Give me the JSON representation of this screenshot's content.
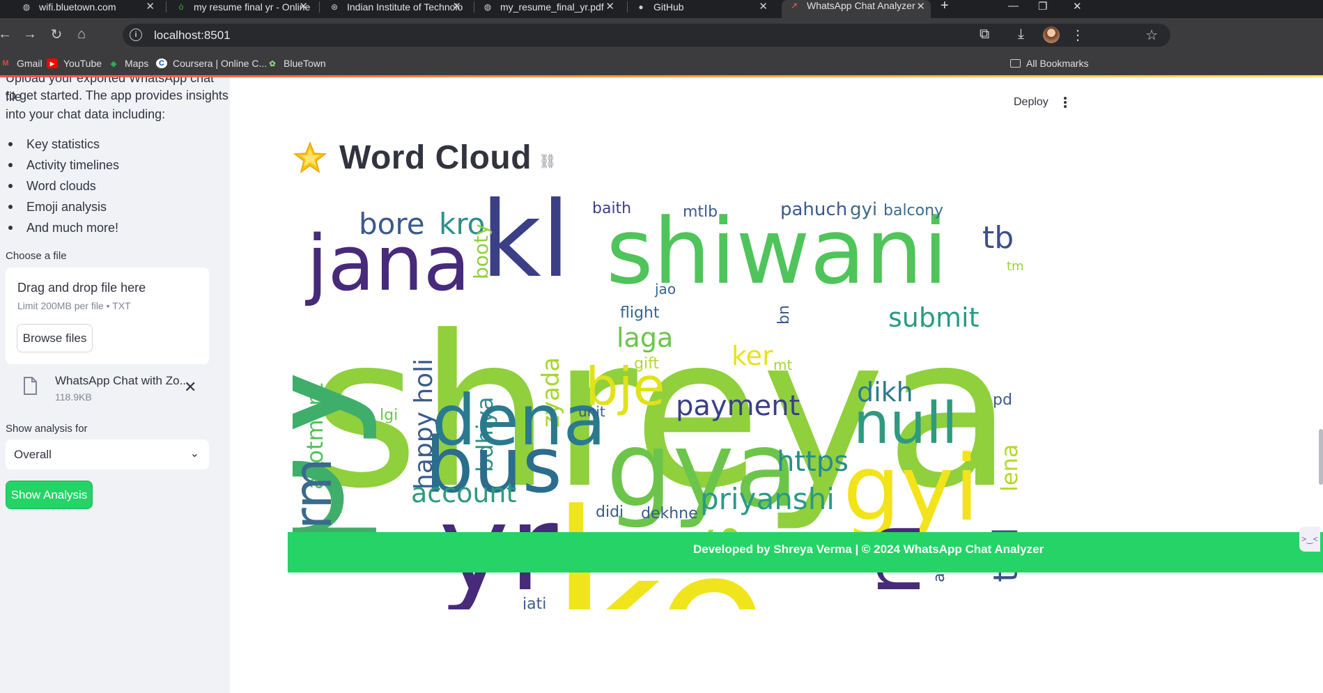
{
  "browser": {
    "tabs": [
      {
        "title": "wifi.bluetown.com",
        "active": false
      },
      {
        "title": "my resume final yr - Online",
        "active": false
      },
      {
        "title": "Indian Institute of Technolo",
        "active": false
      },
      {
        "title": "my_resume_final_yr.pdf",
        "active": false
      },
      {
        "title": "GitHub",
        "active": false
      },
      {
        "title": "WhatsApp Chat Analyzer",
        "active": true
      }
    ],
    "new_tab_label": "+",
    "url": "localhost:8501",
    "bookmarks": [
      {
        "label": "Gmail",
        "icon": "gmail-icon"
      },
      {
        "label": "YouTube",
        "icon": "youtube-icon"
      },
      {
        "label": "Maps",
        "icon": "maps-icon"
      },
      {
        "label": "Coursera | Online C...",
        "icon": "coursera-icon"
      },
      {
        "label": "BlueTown",
        "icon": "bluetown-icon"
      }
    ],
    "all_bookmarks_label": "All Bookmarks"
  },
  "sidebar": {
    "intro_line1": "Upload your exported WhatsApp chat file",
    "intro_line2": "to get started. The app provides insights",
    "intro_line3": "into your chat data including:",
    "features": [
      "Key statistics",
      "Activity timelines",
      "Word clouds",
      "Emoji analysis",
      "And much more!"
    ],
    "file_label": "Choose a file",
    "dropzone_title": "Drag and drop file here",
    "dropzone_limit": "Limit 200MB per file • TXT",
    "browse_label": "Browse files",
    "uploaded_file_name": "WhatsApp Chat with Zo...",
    "uploaded_file_size": "118.9KB",
    "analysis_label": "Show analysis for",
    "analysis_value": "Overall",
    "show_button": "Show Analysis"
  },
  "main": {
    "deploy_label": "Deploy",
    "heading": "Word Cloud",
    "footer": "Developed by Shreya Verma | © 2024 WhatsApp Chat Analyzer"
  },
  "wordcloud": {
    "words": [
      {
        "text": "shreya",
        "color": "#8fd03c"
      },
      {
        "text": "shiwani",
        "color": "#4fc45a"
      },
      {
        "text": "kl",
        "color": "#3b3f86"
      },
      {
        "text": "jana",
        "color": "#472a7a"
      },
      {
        "text": "bore",
        "color": "#3a5a8c"
      },
      {
        "text": "kro",
        "color": "#2e8e8a"
      },
      {
        "text": "baith",
        "color": "#3b3f86"
      },
      {
        "text": "mtlb",
        "color": "#3a5a8c"
      },
      {
        "text": "pahuch",
        "color": "#3a5a8c"
      },
      {
        "text": "gyi",
        "color": "#3b6a8c"
      },
      {
        "text": "balcony",
        "color": "#3b6a8c"
      },
      {
        "text": "tb",
        "color": "#3b4f8c"
      },
      {
        "text": "tm",
        "color": "#9ed03a"
      },
      {
        "text": "booty",
        "color": "#8fd03c"
      },
      {
        "text": "jao",
        "color": "#31688e"
      },
      {
        "text": "flight",
        "color": "#31688e"
      },
      {
        "text": "bn",
        "color": "#3b5a8c"
      },
      {
        "text": "submit",
        "color": "#2a9a86"
      },
      {
        "text": "laga",
        "color": "#6cc54a"
      },
      {
        "text": "allotment",
        "color": "#4fc45a"
      },
      {
        "text": "happy holi",
        "color": "#3a5a8c"
      },
      {
        "text": "zyada",
        "color": "#a6d72c"
      },
      {
        "text": "bdhiya",
        "color": "#2e8e8a"
      },
      {
        "text": "bje",
        "color": "#e0e21a"
      },
      {
        "text": "gift",
        "color": "#b5d929"
      },
      {
        "text": "ker",
        "color": "#e8e21e"
      },
      {
        "text": "mt",
        "color": "#a6d72c"
      },
      {
        "text": "dikh",
        "color": "#2a7a8e"
      },
      {
        "text": "null",
        "color": "#2e9a80"
      },
      {
        "text": "pd",
        "color": "#3a5a8c"
      },
      {
        "text": "dena",
        "color": "#2a7a8e"
      },
      {
        "text": "lgi",
        "color": "#6cc54a"
      },
      {
        "text": "unit",
        "color": "#3a5a8c"
      },
      {
        "text": "payment",
        "color": "#3a3f88"
      },
      {
        "text": "bus",
        "color": "#2b6d8d"
      },
      {
        "text": "gya",
        "color": "#6cc54a"
      },
      {
        "text": "https",
        "color": "#2a8a8a"
      },
      {
        "text": "gyi",
        "color": "#f2e31a"
      },
      {
        "text": "lena",
        "color": "#b5d929"
      },
      {
        "text": "account",
        "color": "#2e9a80"
      },
      {
        "text": "priyanshi",
        "color": "#2a9a86"
      },
      {
        "text": "py",
        "color": "#3fae6a"
      },
      {
        "text": "orm",
        "color": "#3a6a8c"
      },
      {
        "text": "yr",
        "color": "#472a7a"
      },
      {
        "text": "didi",
        "color": "#3a5a8c"
      },
      {
        "text": "dekhne",
        "color": "#3a5a8c"
      },
      {
        "text": "s",
        "color": "#a6d72c"
      },
      {
        "text": "m",
        "color": "#472a7a"
      },
      {
        "text": "ted",
        "color": "#3a4f8c"
      },
      {
        "text": "age",
        "color": "#3a4f8c"
      },
      {
        "text": "jati",
        "color": "#3a5a8c"
      },
      {
        "text": "ke",
        "color": "#f0e41c"
      },
      {
        "text": "l",
        "color": "#f0e41c"
      }
    ]
  },
  "colors": {
    "accent_green": "#25d366",
    "sidebar_bg": "#f0f2f6",
    "text": "#31333f"
  }
}
